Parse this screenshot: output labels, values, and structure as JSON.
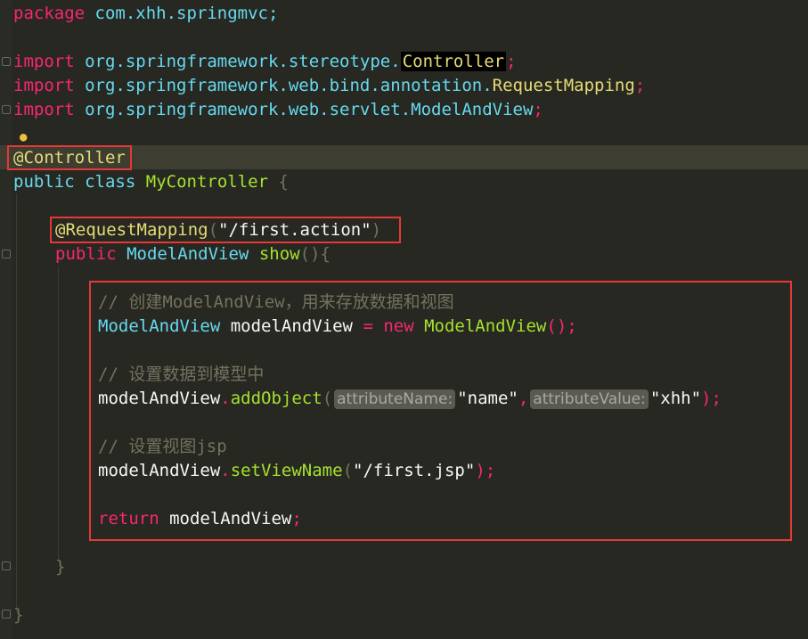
{
  "code": {
    "line1": {
      "kw": "package",
      "rest": " com.xhh.springmvc;"
    },
    "imp1": {
      "kw": "import",
      "pkg": " org.springframework.stereotype.",
      "cls": "Controller",
      "end": ";"
    },
    "imp2": {
      "kw": "import",
      "pkg": " org.springframework.web.bind.annotation.",
      "cls": "RequestMapping",
      "end": ";"
    },
    "imp3": {
      "kw": "import",
      "pkg": " org.springframework.web.servlet.",
      "cls": "ModelAndView",
      "end": ";"
    },
    "annotation": "@Controller",
    "classdecl": {
      "kw1": "public",
      "kw2": "class",
      "name": "MyController",
      "brace": " {"
    },
    "mapping": {
      "ann": "@RequestMapping",
      "open": "(",
      "str": "\"/first.action\"",
      "close": ")"
    },
    "method": {
      "kw": "public",
      "type": "ModelAndView",
      "name": "show",
      "parens": "(){"
    },
    "comment1": "// 创建ModelAndView，用来存放数据和视图",
    "decl": {
      "type": "ModelAndView",
      "var": " modelAndView ",
      "eq": "=",
      "new": " new ",
      "ctor": "ModelAndView",
      "end": "();"
    },
    "comment2": "// 设置数据到模型中",
    "addobj": {
      "obj": "modelAndView",
      "dot": ".",
      "fn": "addObject",
      "open": "(",
      "hint1": "attributeName:",
      "str1": "\"name\"",
      "comma": ",",
      "hint2": "attributeValue:",
      "str2": "\"xhh\"",
      "end": ");"
    },
    "comment3": "// 设置视图jsp",
    "setview": {
      "obj": "modelAndView",
      "dot": ".",
      "fn": "setViewName",
      "open": "(",
      "str": "\"/first.jsp\"",
      "end": ");"
    },
    "ret": {
      "kw": "return",
      "rest": " modelAndView",
      "end": ";"
    },
    "close_method": "}",
    "close_class": "}"
  },
  "colors": {
    "background": "#272822",
    "keyword": "#f92672",
    "type": "#66d9ef",
    "function": "#a6e22e",
    "string": "#e6db74",
    "highlight_box": "#e53935"
  },
  "icons": {
    "bulb": "lightbulb-icon"
  }
}
